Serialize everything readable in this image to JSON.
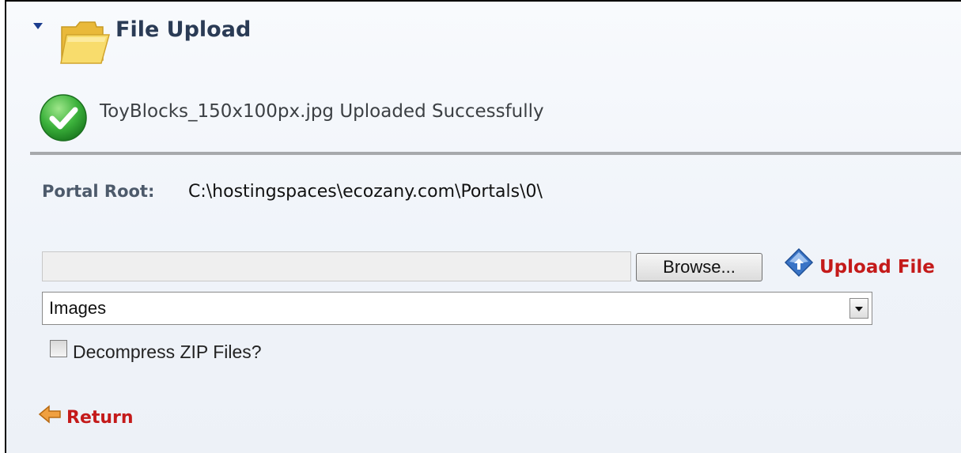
{
  "section": {
    "title": "File Upload",
    "collapse_icon": "triangle-down-icon",
    "folder_icon": "folder-icon"
  },
  "status": {
    "icon": "checkmark-circle-icon",
    "message": "ToyBlocks_150x100px.jpg Uploaded Successfully"
  },
  "portal": {
    "label": "Portal Root:",
    "value": "C:\\hostingspaces\\ecozany.com\\Portals\\0\\"
  },
  "upload": {
    "file_value": "",
    "browse_label": "Browse...",
    "upload_icon": "upload-diamond-icon",
    "upload_label": "Upload File"
  },
  "folder_select": {
    "selected": "Images"
  },
  "decompress": {
    "label": "Decompress ZIP Files?",
    "checked": false
  },
  "return_link": {
    "icon": "arrow-left-icon",
    "label": "Return"
  },
  "colors": {
    "link_red": "#c41a1a",
    "title_dark": "#2a3b55",
    "success_green": "#3bb13b",
    "folder_yellow": "#f6d255"
  }
}
